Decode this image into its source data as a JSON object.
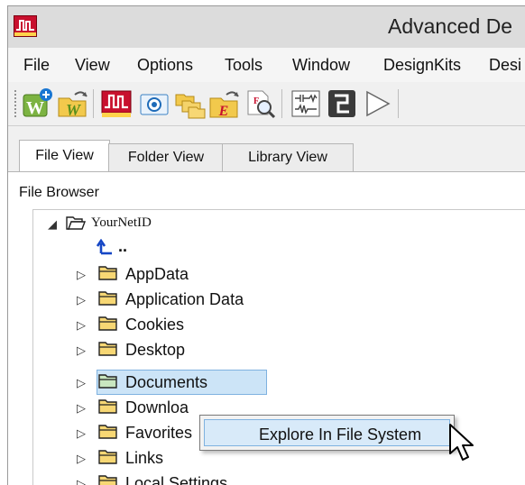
{
  "window": {
    "title": "Advanced De"
  },
  "menu": [
    "File",
    "View",
    "Options",
    "Tools",
    "Window",
    "DesignKits",
    "Desi"
  ],
  "toolbar": {
    "icons": [
      "new-workspace-icon",
      "open-workspace-icon",
      "simulation-icon",
      "screenshot-icon",
      "copy-project-icon",
      "open-example-icon",
      "find-icon",
      "schematic-icon",
      "layout-icon",
      "play-icon"
    ]
  },
  "tabs": [
    "File View",
    "Folder View",
    "Library View"
  ],
  "panel": {
    "title": "File Browser"
  },
  "tree": {
    "root": "YourNetID",
    "up": "..",
    "items": [
      "AppData",
      "Application Data",
      "Cookies",
      "Desktop",
      "Documents",
      "Downloa",
      "Favorites",
      "Links",
      "Local Settings"
    ]
  },
  "context_menu": {
    "item": "Explore In File System"
  },
  "colors": {
    "accent": "#c8102e",
    "selection": "#cce4f7",
    "folder": "#f7d774"
  }
}
